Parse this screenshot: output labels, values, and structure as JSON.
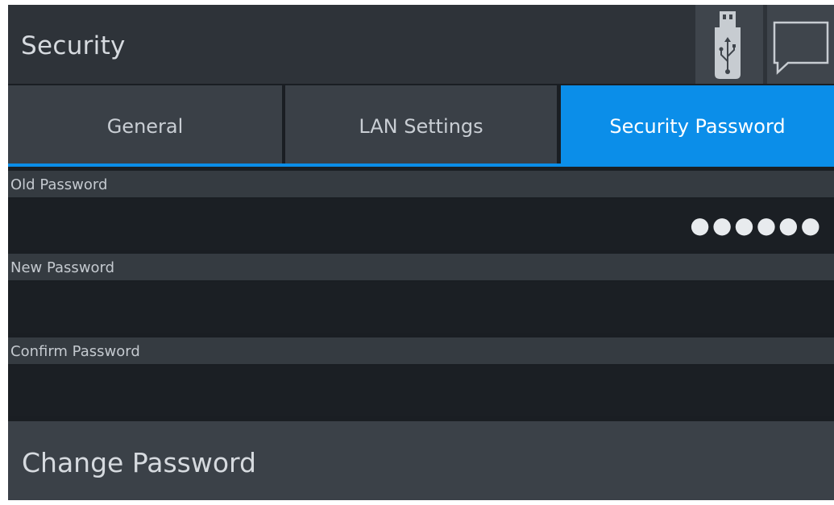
{
  "header": {
    "title": "Security",
    "icons": [
      "usb-icon",
      "message-icon"
    ]
  },
  "tabs": [
    {
      "label": "General",
      "active": false
    },
    {
      "label": "LAN Settings",
      "active": false
    },
    {
      "label": "Security Password",
      "active": true
    }
  ],
  "fields": {
    "old_password": {
      "label": "Old Password",
      "value": "●●●●●●"
    },
    "new_password": {
      "label": "New Password",
      "value": ""
    },
    "confirm_password": {
      "label": "Confirm Password",
      "value": ""
    }
  },
  "actions": {
    "change_password_label": "Change Password"
  },
  "colors": {
    "accent": "#0b8ee9",
    "background": "#1a1e23",
    "panel": "#3a4047"
  }
}
